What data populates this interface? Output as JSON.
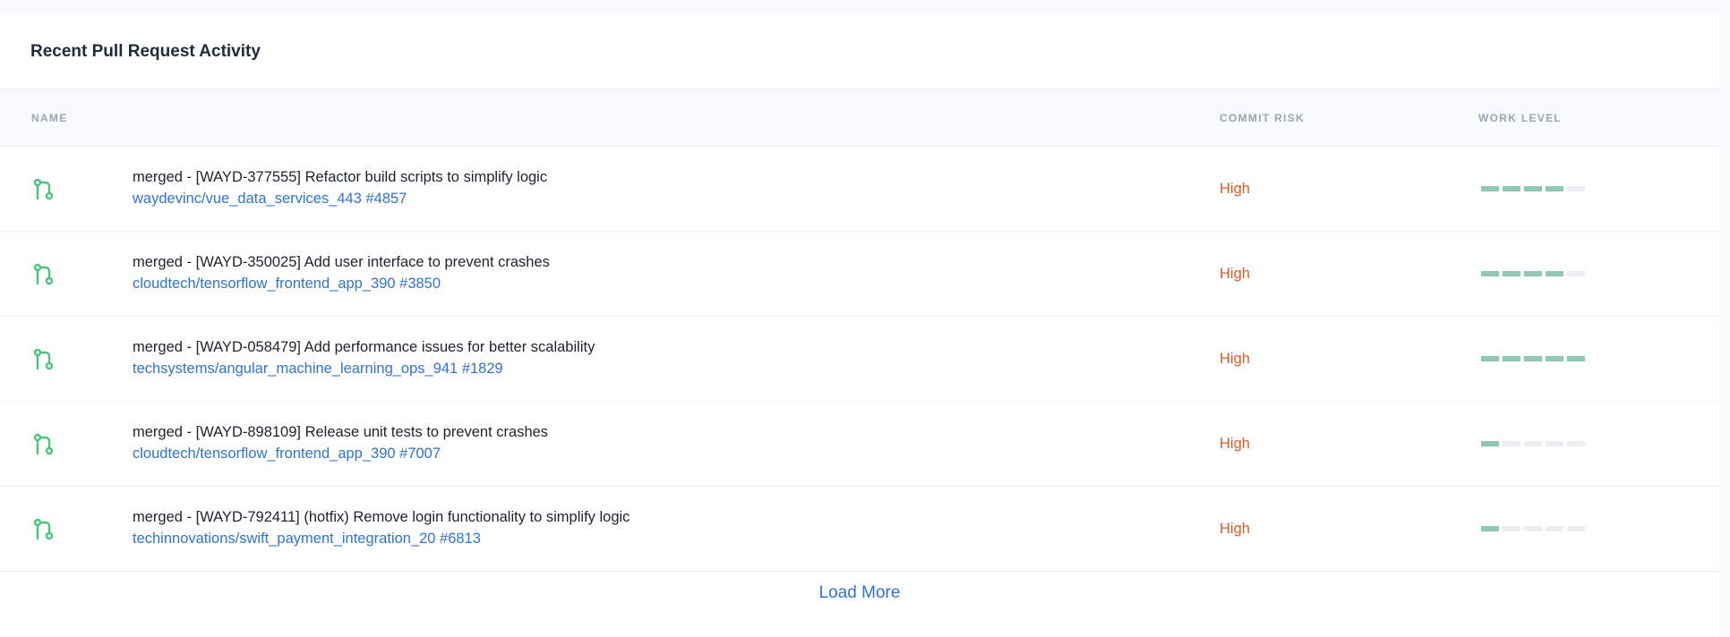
{
  "card": {
    "title": "Recent Pull Request Activity"
  },
  "table": {
    "columns": {
      "name": "NAME",
      "commit_risk": "COMMIT RISK",
      "work_level": "WORK LEVEL"
    },
    "rows": [
      {
        "icon": "git-pull-request-icon",
        "title": "merged - [WAYD-377555] Refactor build scripts to simplify logic",
        "repo": "waydevinc/vue_data_services_443 #4857",
        "risk": "High",
        "work_level": 4,
        "work_level_max": 5
      },
      {
        "icon": "git-pull-request-icon",
        "title": "merged - [WAYD-350025] Add user interface to prevent crashes",
        "repo": "cloudtech/tensorflow_frontend_app_390 #3850",
        "risk": "High",
        "work_level": 4,
        "work_level_max": 5
      },
      {
        "icon": "git-pull-request-icon",
        "title": "merged - [WAYD-058479] Add performance issues for better scalability",
        "repo": "techsystems/angular_machine_learning_ops_941 #1829",
        "risk": "High",
        "work_level": 5,
        "work_level_max": 5
      },
      {
        "icon": "git-pull-request-icon",
        "title": "merged - [WAYD-898109] Release unit tests to prevent crashes",
        "repo": "cloudtech/tensorflow_frontend_app_390 #7007",
        "risk": "High",
        "work_level": 1,
        "work_level_max": 5
      },
      {
        "icon": "git-pull-request-icon",
        "title": "merged - [WAYD-792411] (hotfix) Remove login functionality to simplify logic",
        "repo": "techinnovations/swift_payment_integration_20 #6813",
        "risk": "High",
        "work_level": 1,
        "work_level_max": 5
      }
    ]
  },
  "footer": {
    "load_more_label": "Load More"
  },
  "colors": {
    "icon": "#4cc37e",
    "link": "#2f74d0",
    "risk_high": "#e05a24",
    "work_on": "#8fc9b6",
    "work_off": "#eceef1"
  }
}
